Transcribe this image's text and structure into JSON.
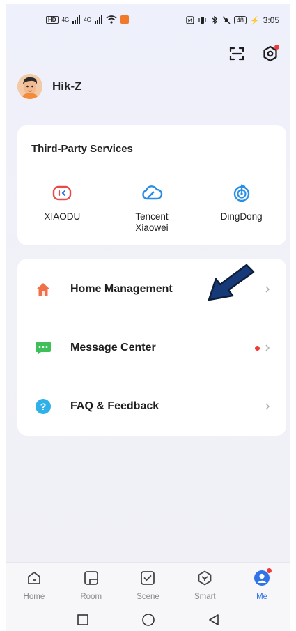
{
  "status_bar": {
    "left_box": "HD",
    "network_1": "4G",
    "network_2": "4G",
    "battery": "48",
    "time": "3:05"
  },
  "profile": {
    "username": "Hik-Z"
  },
  "third_party": {
    "title": "Third-Party Services",
    "items": [
      {
        "label": "XIAODU",
        "icon": "xiaodu-icon",
        "color": "#e84a4a"
      },
      {
        "label": "Tencent\nXiaowei",
        "icon": "tencent-cloud-icon",
        "color": "#2b8ce8"
      },
      {
        "label": "DingDong",
        "icon": "dingdong-icon",
        "color": "#2a8fe6"
      }
    ]
  },
  "menu": [
    {
      "label": "Home Management",
      "icon": "home-icon",
      "color": "#f07048"
    },
    {
      "label": "Message Center",
      "icon": "message-icon",
      "color": "#3fbf5a",
      "badge": true
    },
    {
      "label": "FAQ & Feedback",
      "icon": "help-icon",
      "color": "#2fb0e8"
    }
  ],
  "tabs": [
    {
      "label": "Home",
      "icon": "home-tab-icon"
    },
    {
      "label": "Room",
      "icon": "room-tab-icon"
    },
    {
      "label": "Scene",
      "icon": "scene-tab-icon"
    },
    {
      "label": "Smart",
      "icon": "smart-tab-icon"
    },
    {
      "label": "Me",
      "icon": "me-tab-icon",
      "active": true
    }
  ],
  "colors": {
    "accent": "#2f74e8",
    "badge": "#ee3b3b"
  }
}
